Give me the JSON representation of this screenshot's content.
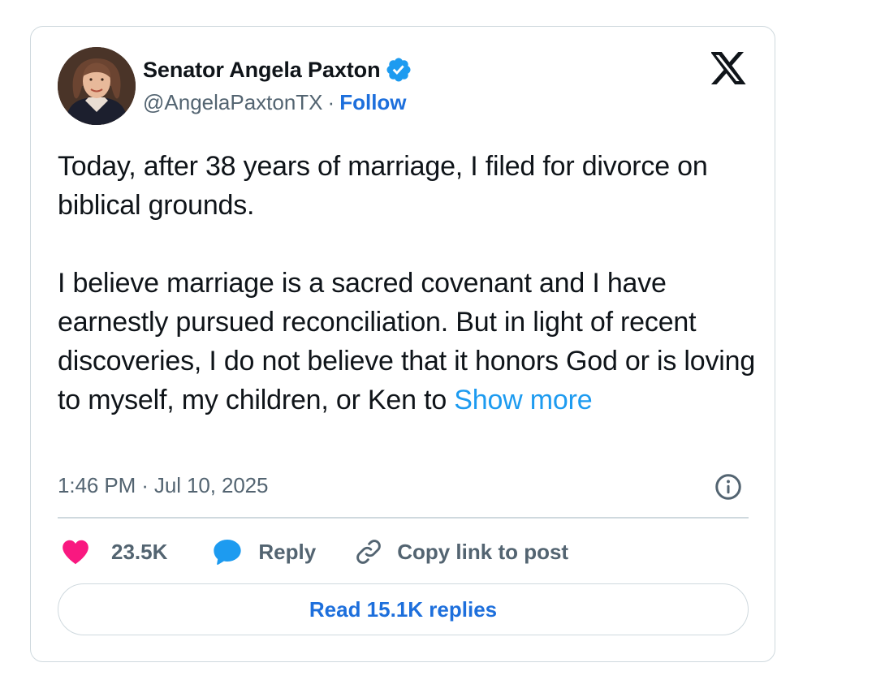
{
  "author": {
    "name": "Senator Angela Paxton",
    "handle": "@AngelaPaxtonTX",
    "separator": "·",
    "follow_label": "Follow",
    "verified": true,
    "avatar_icon": "profile-photo"
  },
  "brand_icon": "x-logo-icon",
  "tweet": {
    "paragraph_1": "Today, after 38 years of marriage, I filed for divorce on biblical grounds.",
    "paragraph_2": "I believe marriage is a sacred covenant and I have earnestly pursued reconciliation. But in light of recent discoveries, I do not believe that it honors God or is loving to myself, my children, or Ken to",
    "show_more_label": "Show more"
  },
  "timestamp": "1:46 PM · Jul 10, 2025",
  "actions": {
    "like_count": "23.5K",
    "reply_label": "Reply",
    "copy_link_label": "Copy link to post"
  },
  "read_replies_label": "Read 15.1K replies",
  "colors": {
    "link_blue": "#1d9bf0",
    "action_blue": "#1d6fdc",
    "heart_pink": "#f91880",
    "muted_text": "#536471",
    "border": "#cfd9de"
  }
}
